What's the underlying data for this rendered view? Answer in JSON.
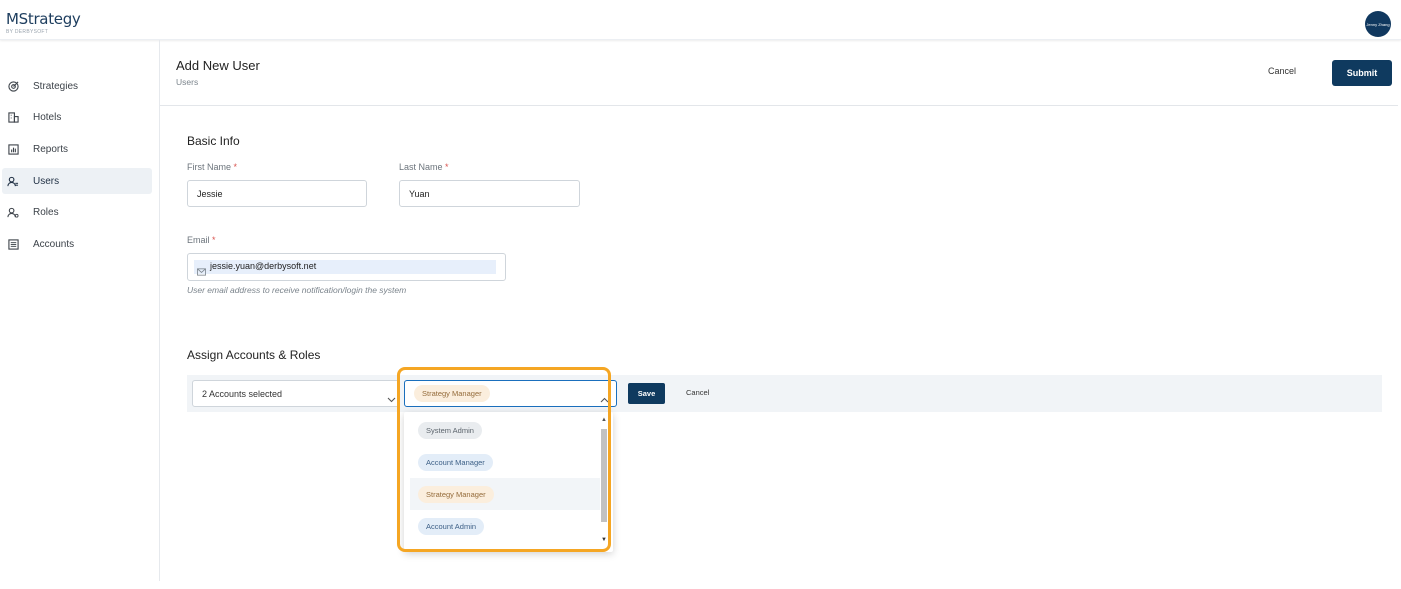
{
  "app": {
    "logo_main": "MStrategy",
    "logo_sub": "BY DERBYSOFT",
    "user_initials": "Jenny Zhang"
  },
  "sidebar": {
    "items": [
      {
        "label": "Strategies",
        "icon": "target-icon",
        "active": false
      },
      {
        "label": "Hotels",
        "icon": "building-icon",
        "active": false
      },
      {
        "label": "Reports",
        "icon": "chart-icon",
        "active": false
      },
      {
        "label": "Users",
        "icon": "users-icon",
        "active": true
      },
      {
        "label": "Roles",
        "icon": "user-role-icon",
        "active": false
      },
      {
        "label": "Accounts",
        "icon": "accounts-icon",
        "active": false
      }
    ]
  },
  "header": {
    "title": "Add New User",
    "breadcrumb": "Users",
    "cancel_label": "Cancel",
    "submit_label": "Submit"
  },
  "basic_info": {
    "section_title": "Basic Info",
    "first_name_label": "First Name",
    "first_name_value": "Jessie",
    "last_name_label": "Last Name",
    "last_name_value": "Yuan",
    "required_mark": "*",
    "email_label": "Email",
    "email_value": "jessie.yuan@derbysoft.net",
    "email_hint": "User email address to receive notification/login the system"
  },
  "assign": {
    "section_title": "Assign Accounts & Roles",
    "accounts_value": "2 Accounts selected",
    "selected_role": "Strategy Manager",
    "save_label": "Save",
    "cancel_label": "Cancel",
    "role_options": [
      "System Admin",
      "Account Manager",
      "Strategy Manager",
      "Account Admin"
    ]
  },
  "colors": {
    "primary": "#0f3a5f",
    "highlight": "#f5a623",
    "required": "#d9534f"
  }
}
